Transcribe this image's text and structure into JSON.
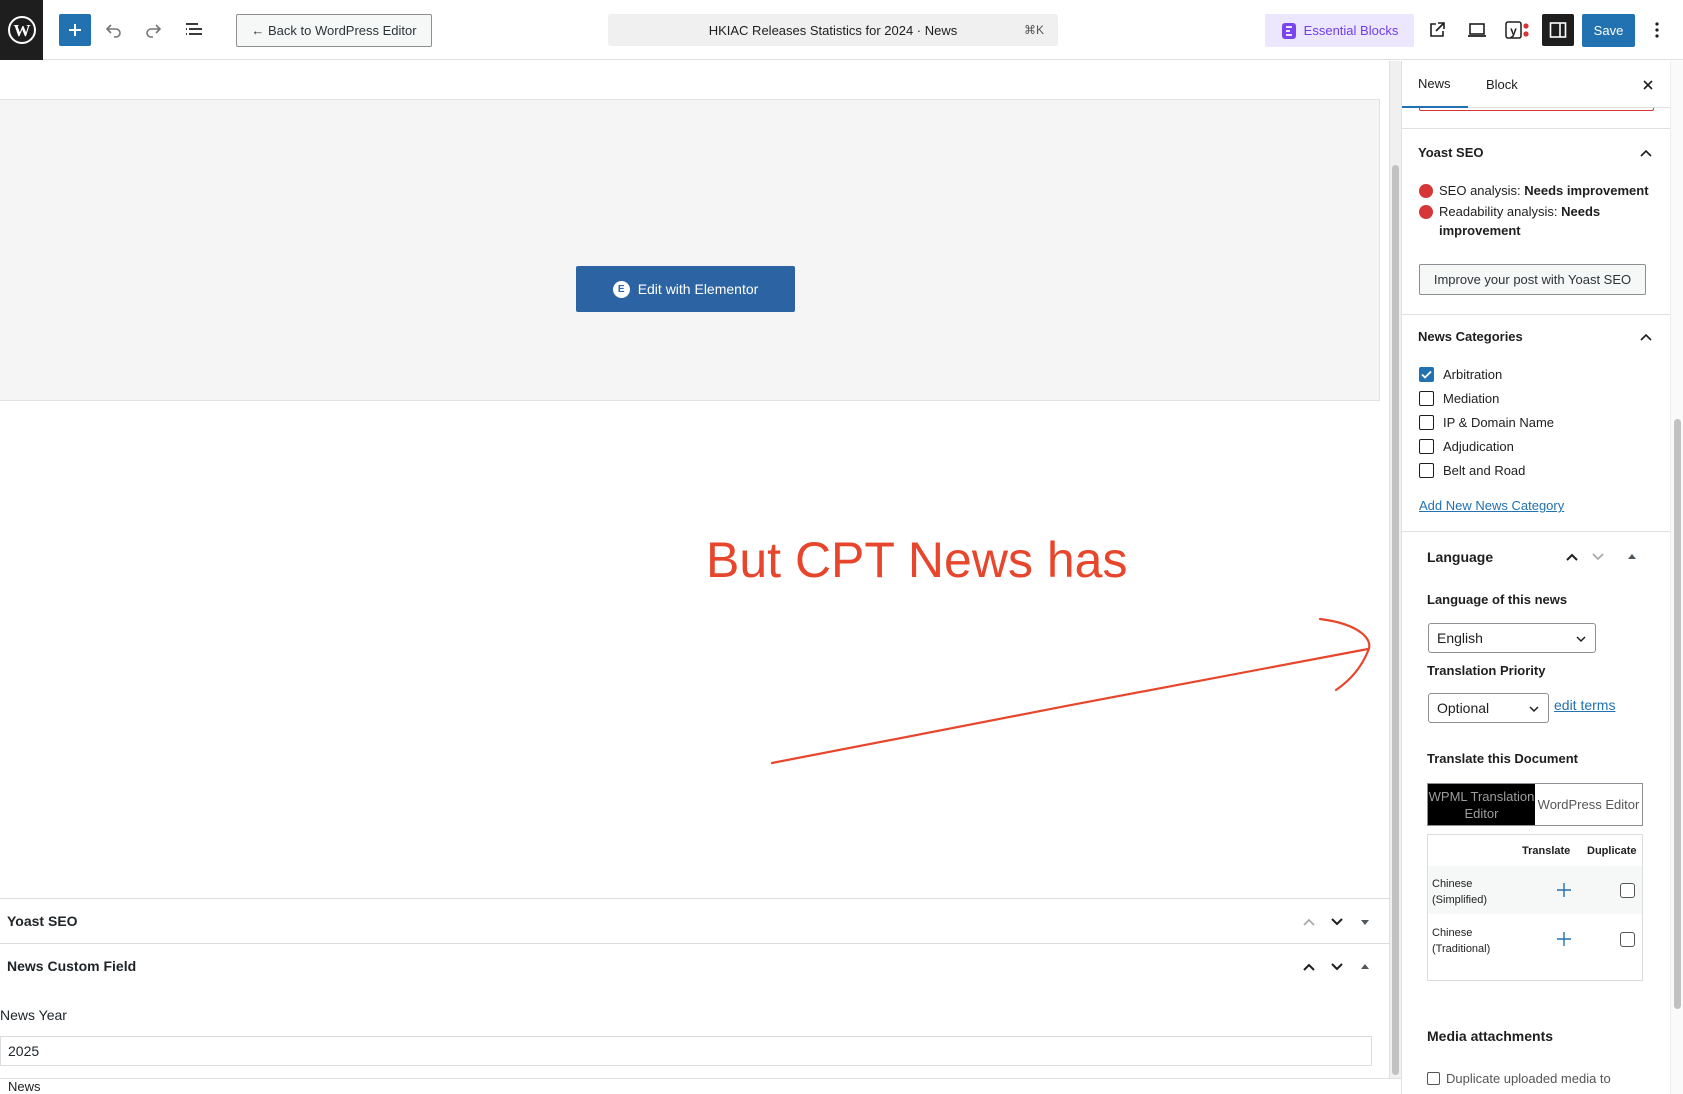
{
  "topbar": {
    "back_label": "← Back to WordPress Editor",
    "doc_title": "HKIAC Releases Statistics for 2024 · News",
    "shortcut": "⌘K",
    "essential_blocks_label": "Essential Blocks",
    "save_label": "Save"
  },
  "canvas": {
    "elementor_button_label": "Edit with Elementor",
    "annotation_text": "But CPT News has",
    "annotation_color": "#e8462c"
  },
  "metaboxes": {
    "yoast_title": "Yoast SEO",
    "news_custom_field_title": "News Custom Field",
    "news_year_label": "News Year",
    "news_year_value": "2025",
    "bottom_crumb": "News"
  },
  "sidebar": {
    "tabs": [
      {
        "label": "News",
        "active": true
      },
      {
        "label": "Block",
        "active": false
      }
    ],
    "yoast": {
      "title": "Yoast SEO",
      "seo_label": "SEO analysis: ",
      "seo_value": "Needs improvement",
      "readability_label": "Readability analysis: ",
      "readability_value": "Needs improvement",
      "improve_button": "Improve your post with Yoast SEO"
    },
    "news_categories": {
      "title": "News Categories",
      "items": [
        {
          "label": "Arbitration",
          "checked": true
        },
        {
          "label": "Mediation",
          "checked": false
        },
        {
          "label": "IP & Domain Name",
          "checked": false
        },
        {
          "label": "Adjudication",
          "checked": false
        },
        {
          "label": "Belt and Road",
          "checked": false
        }
      ],
      "add_new_link": "Add New News Category"
    },
    "language": {
      "title": "Language",
      "language_of_label": "Language of this news",
      "language_value": "English",
      "priority_label": "Translation Priority",
      "priority_value": "Optional",
      "edit_terms_link": "edit terms",
      "translate_doc_label": "Translate this Document",
      "toggle_active": "WPML Translation Editor",
      "toggle_inactive": "WordPress Editor",
      "table_headers": {
        "translate": "Translate",
        "duplicate": "Duplicate"
      },
      "rows": [
        {
          "language": "Chinese (Simplified)"
        },
        {
          "language": "Chinese (Traditional)"
        }
      ],
      "media_title": "Media attachments",
      "media_option": "Duplicate uploaded media to"
    }
  },
  "colors": {
    "primary": "#2271b1",
    "elementor": "#2b63a3",
    "essential_blocks_bg": "#ece6ff",
    "essential_blocks_text": "#6f3ee8",
    "seo_bad": "#d63638"
  }
}
